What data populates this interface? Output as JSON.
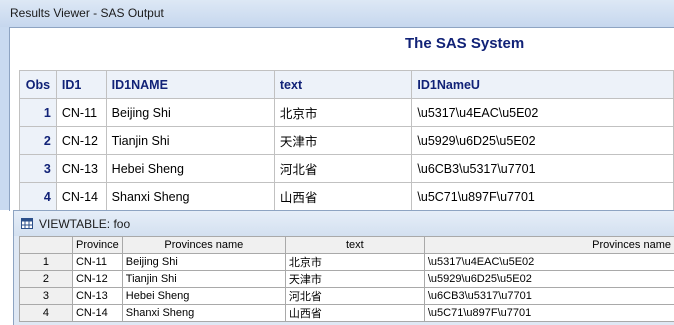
{
  "results_viewer": {
    "title": "Results Viewer - SAS Output",
    "system_title": "The SAS System",
    "columns": [
      "Obs",
      "ID1",
      "ID1NAME",
      "text",
      "ID1NameU"
    ],
    "rows": [
      {
        "obs": "1",
        "id1": "CN-11",
        "name": "Beijing Shi",
        "text": "北京市",
        "nameu": "\\u5317\\u4EAC\\u5E02"
      },
      {
        "obs": "2",
        "id1": "CN-12",
        "name": "Tianjin Shi",
        "text": "天津市",
        "nameu": "\\u5929\\u6D25\\u5E02"
      },
      {
        "obs": "3",
        "id1": "CN-13",
        "name": "Hebei Sheng",
        "text": "河北省",
        "nameu": "\\u6CB3\\u5317\\u7701"
      },
      {
        "obs": "4",
        "id1": "CN-14",
        "name": "Shanxi Sheng",
        "text": "山西省",
        "nameu": "\\u5C71\\u897F\\u7701"
      }
    ]
  },
  "viewtable": {
    "title": "VIEWTABLE: foo",
    "icon": "table-grid-icon",
    "columns": [
      "Province",
      "Provinces name",
      "text",
      "Provinces name"
    ],
    "rows": [
      {
        "num": "1",
        "province": "CN-11",
        "name": "Beijing Shi",
        "text": "北京市",
        "nameu": "\\u5317\\u4EAC\\u5E02"
      },
      {
        "num": "2",
        "province": "CN-12",
        "name": "Tianjin Shi",
        "text": "天津市",
        "nameu": "\\u5929\\u6D25\\u5E02"
      },
      {
        "num": "3",
        "province": "CN-13",
        "name": "Hebei Sheng",
        "text": "河北省",
        "nameu": "\\u6CB3\\u5317\\u7701"
      },
      {
        "num": "4",
        "province": "CN-14",
        "name": "Shanxi Sheng",
        "text": "山西省",
        "nameu": "\\u5C71\\u897F\\u7701"
      }
    ]
  }
}
